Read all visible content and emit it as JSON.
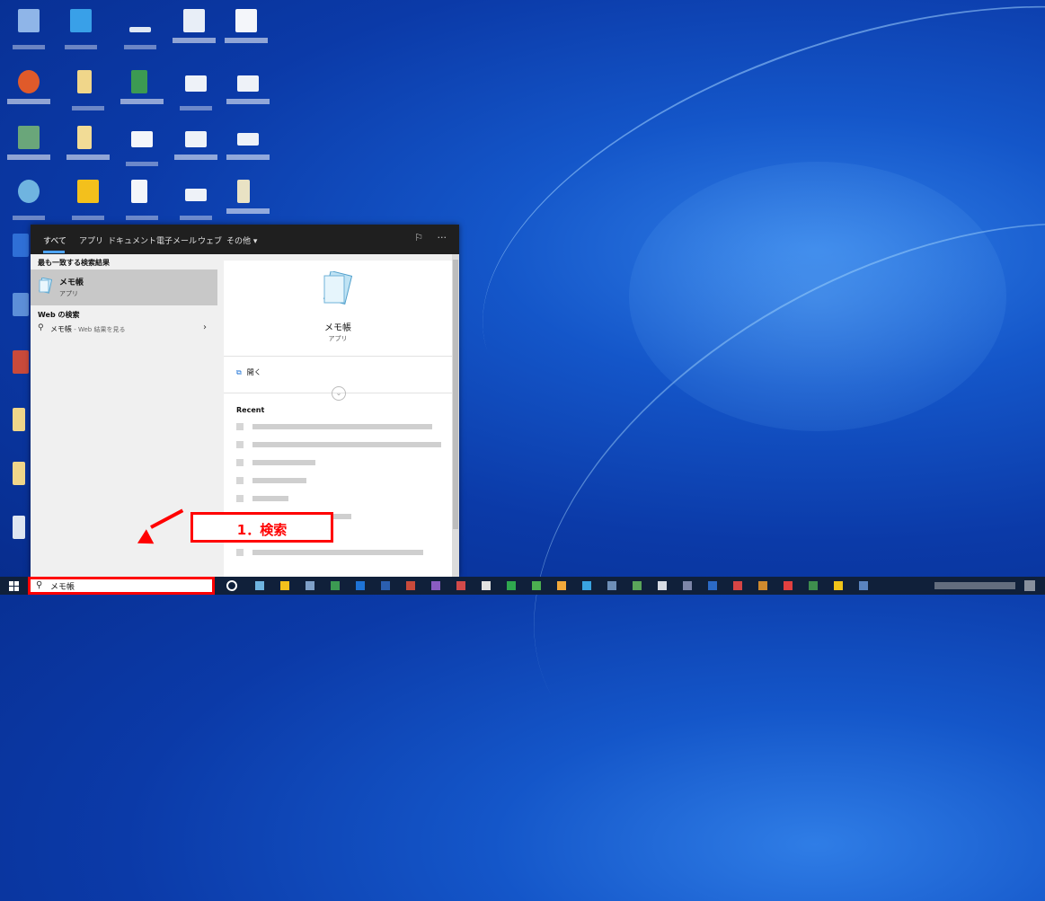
{
  "search_panel": {
    "tabs": [
      "すべて",
      "アプリ",
      "ドキュメント",
      "電子メール",
      "ウェブ",
      "その他 ▾"
    ],
    "best_match_title": "最も一致する検索結果",
    "best_match": {
      "name": "メモ帳",
      "type": "アプリ"
    },
    "web_title": "Web の検索",
    "web_result": {
      "query": "メモ帳",
      "suffix": " - Web 結果を見る"
    },
    "preview": {
      "name": "メモ帳",
      "type": "アプリ",
      "open_label": "開く",
      "recent_title": "Recent"
    }
  },
  "callout": {
    "label": "1．検索",
    "color": "#ff0000"
  },
  "taskbar": {
    "search_value": "メモ帳",
    "search_icon": "search-icon",
    "start_icon": "windows-start-icon"
  },
  "colors": {
    "accent": "#4ca3ff",
    "highlight": "#ff0000",
    "taskbar": "#10203a",
    "selected_row": "#c8c8c8"
  }
}
